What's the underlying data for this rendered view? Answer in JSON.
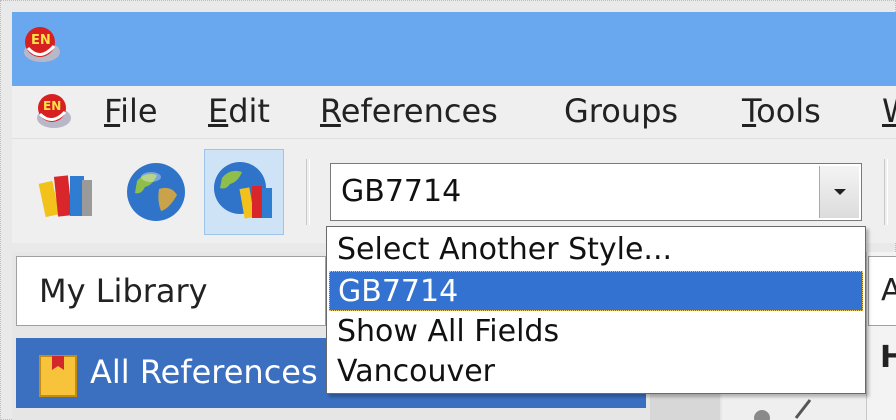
{
  "window": {
    "app_icon": "endnote-app-icon"
  },
  "menubar": {
    "items": [
      {
        "label_ul": "F",
        "label_rest": "ile"
      },
      {
        "label_ul": "E",
        "label_rest": "dit"
      },
      {
        "label_ul": "R",
        "label_rest": "eferences"
      },
      {
        "label_ul": "",
        "label_rest": "Groups"
      },
      {
        "label_ul": "T",
        "label_rest": "ools"
      },
      {
        "label_ul": "W",
        "label_rest": ""
      }
    ]
  },
  "toolbar": {
    "buttons": [
      {
        "icon": "local-library-icon"
      },
      {
        "icon": "online-search-icon"
      },
      {
        "icon": "integrated-library-icon",
        "active": true
      }
    ]
  },
  "style_select": {
    "value": "GB7714",
    "options": [
      "Select Another Style...",
      "GB7714",
      "Show All Fields",
      "Vancouver"
    ],
    "selected_index": 1
  },
  "library": {
    "name": "My Library",
    "group_label": "All References"
  },
  "right_pane": {
    "box_text": "A",
    "heading": "H"
  },
  "colors": {
    "titlebar": "#69a7ef",
    "selection": "#3372d0",
    "group_highlight": "#3b6fc0"
  }
}
